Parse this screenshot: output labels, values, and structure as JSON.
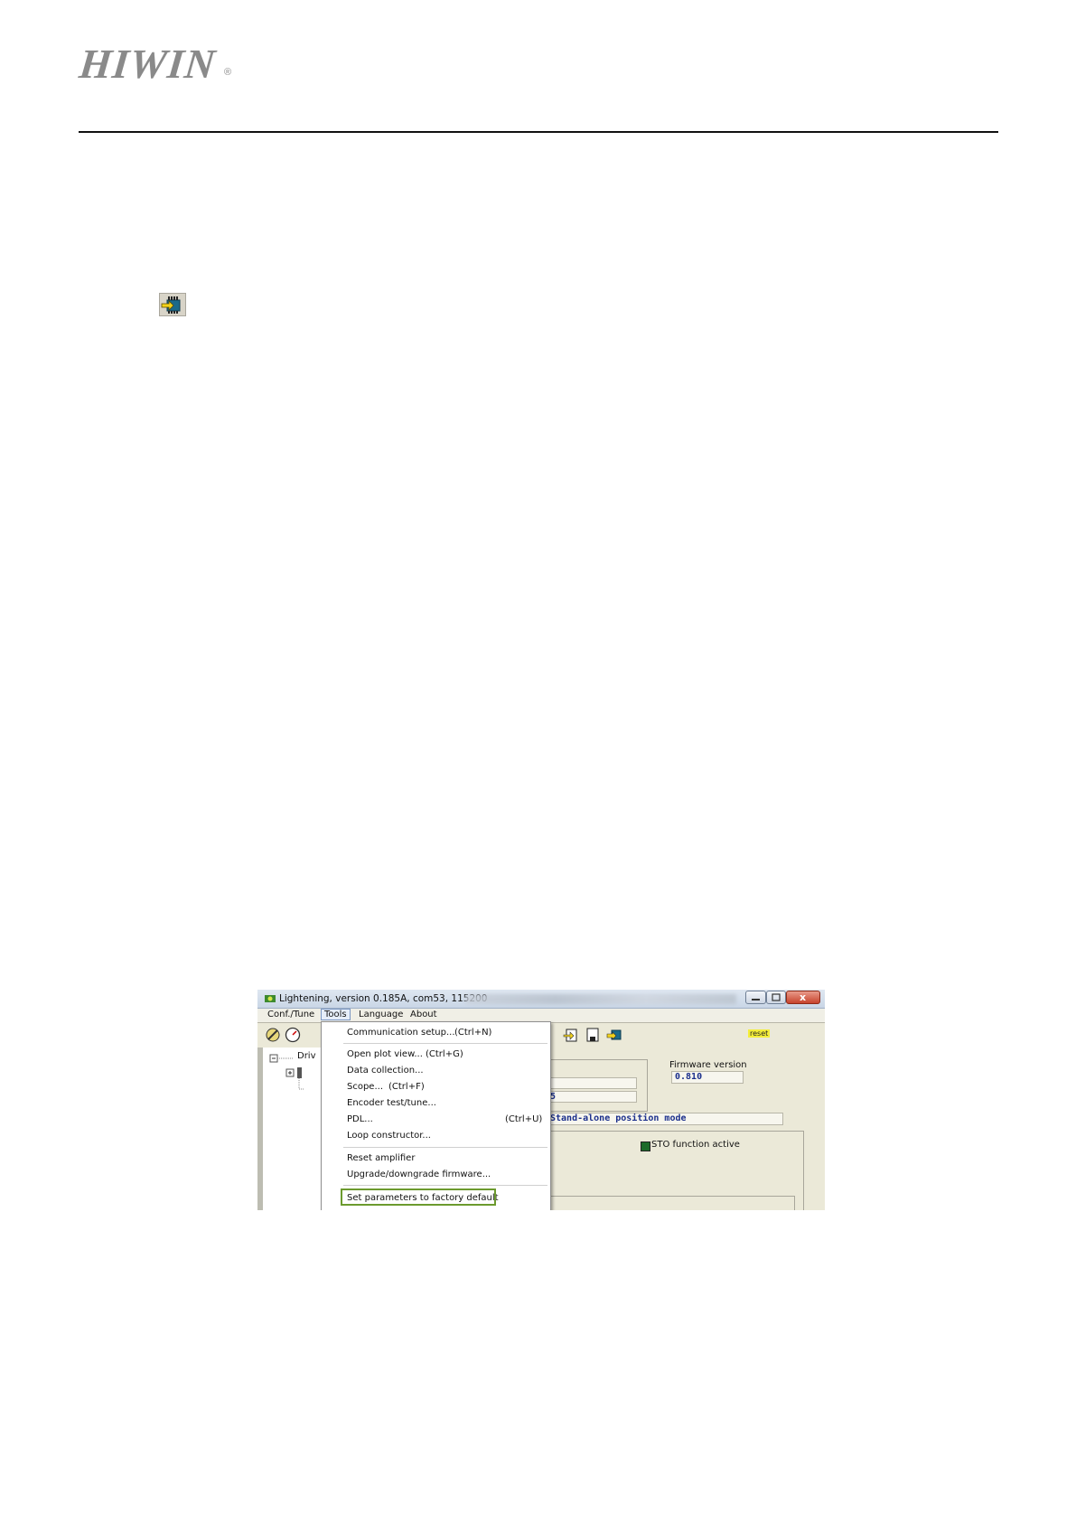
{
  "header": {
    "logo_text": "HIWIN",
    "logo_reg": "®"
  },
  "screenshot": {
    "title": "Lightening, version 0.185A, com53, 115200",
    "close_glyph": "x",
    "menu": [
      "Conf./Tune",
      "Tools",
      "Language",
      "About"
    ],
    "tree_label": "Driv",
    "firmware_label": "Firmware version",
    "firmware_value": "0.810",
    "field_partial_1": "",
    "field_partial_2": "5",
    "mode_value": "Stand-alone position mode",
    "sto_label": "STO function active",
    "reset_label": "reset",
    "dropdown": {
      "communication_setup": "Communication setup...",
      "communication_shortcut": "(Ctrl+N)",
      "open_plot_view": "Open plot view...",
      "open_plot_shortcut": "(Ctrl+G)",
      "data_collection": "Data collection...",
      "scope": "Scope...",
      "scope_shortcut": "(Ctrl+F)",
      "encoder_test": "Encoder test/tune...",
      "pdl": "PDL...",
      "pdl_shortcut": "(Ctrl+U)",
      "loop_constructor": "Loop constructor...",
      "reset_amplifier": "Reset amplifier",
      "upgrade_firmware": "Upgrade/downgrade firmware...",
      "factory_default": "Set parameters to factory default"
    }
  }
}
